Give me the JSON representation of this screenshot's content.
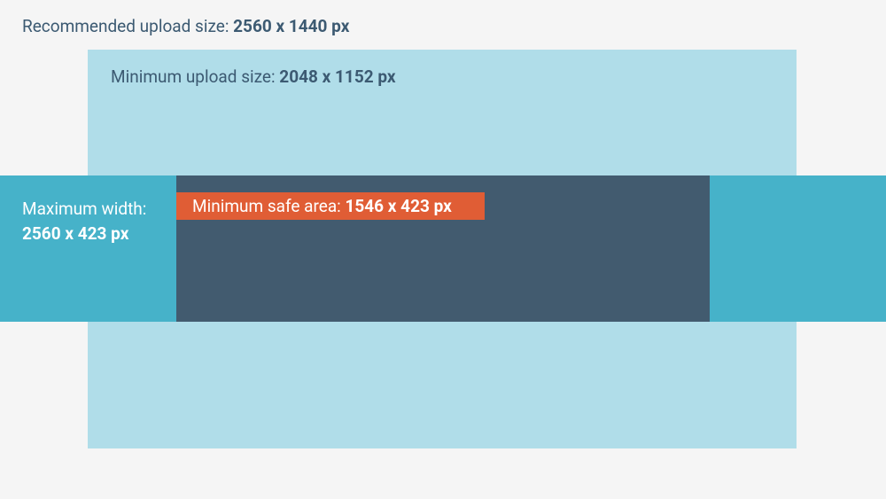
{
  "recommended": {
    "prefix": "Recommended upload size: ",
    "value": "2560 x 1440 px"
  },
  "minimum": {
    "prefix": "Minimum upload size: ",
    "value": "2048 x 1152 px"
  },
  "maxWidth": {
    "prefix": "Maximum width:",
    "value": "2560 x 423 px"
  },
  "safeArea": {
    "prefix": "Minimum safe area: ",
    "value": "1546 x 423 px"
  },
  "colors": {
    "background": "#f5f5f5",
    "lightBlue": "#b0dde9",
    "mediumBlue": "#46b2c9",
    "darkBlue": "#425b6f",
    "orange": "#e05d35",
    "textDark": "#3c5a72",
    "textLight": "#ffffff"
  }
}
